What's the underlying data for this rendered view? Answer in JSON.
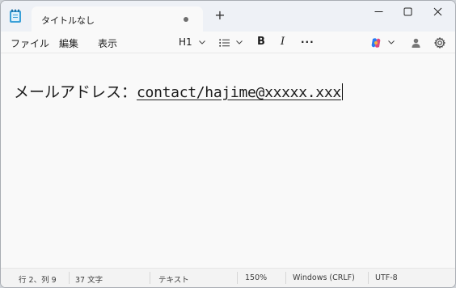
{
  "tab": {
    "title": "タイトルなし"
  },
  "menu": {
    "file": "ファイル",
    "edit": "編集",
    "view": "表示"
  },
  "toolbar": {
    "heading": "H1"
  },
  "editor": {
    "label": "メールアドレス：",
    "link": "contact/hajime@xxxxx.xxx"
  },
  "status": {
    "position": "行 2、列 9",
    "chars": "37 文字",
    "format": "テキスト",
    "zoom": "150%",
    "line_ending": "Windows (CRLF)",
    "encoding": "UTF-8"
  },
  "icons": {
    "app": "notepad-icon",
    "new_tab": "plus-icon",
    "minimize": "minimize-icon",
    "maximize": "maximize-icon",
    "close": "close-icon",
    "list": "list-icon",
    "bold": "bold-icon",
    "italic": "italic-icon",
    "more": "more-icon",
    "copilot": "copilot-icon",
    "account": "account-icon",
    "settings": "gear-icon"
  }
}
